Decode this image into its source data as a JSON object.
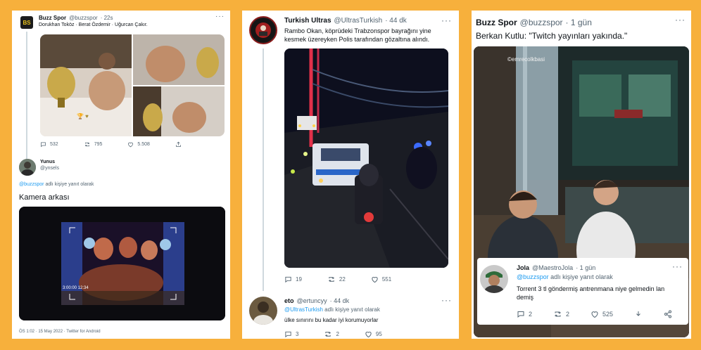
{
  "panel1": {
    "tweet": {
      "avatar_text": "BS",
      "name": "Buzz Spor",
      "handle": "@buzzspor",
      "time": "· 22s",
      "more": "···",
      "text": "Dorukhan Toköz · Berat Özdemir · Uğurcan Çakır.",
      "media_caption": "🏆 ♥",
      "reply_count": "532",
      "retweet_count": "795",
      "like_count": "5.508"
    },
    "reply": {
      "name": "Yunus",
      "handle": "@ynsels",
      "replying_to_handle": "@buzzspor",
      "replying_to_suffix": " adlı kişiye yanıt olarak",
      "text": "Kamera arkası",
      "video_timestamp": "3:00:00 12:34",
      "meta": "ÖS 1:02 · 15 May 2022 · Twitter for Android"
    }
  },
  "panel2": {
    "tweet": {
      "name": "Turkish Ultras",
      "handle": "@UltrasTurkish",
      "time": "· 44 dk",
      "more": "···",
      "avatar_text": "TURKISH ULTRAS",
      "text": "Rambo Okan, köprüdeki Trabzonspor bayrağını yine kesmek üzereyken Polis tarafından gözaltına alındı.",
      "reply_count": "19",
      "retweet_count": "22",
      "like_count": "551"
    },
    "reply": {
      "name": "eto",
      "handle": "@ertuncyy",
      "time": "· 44 dk",
      "more": "···",
      "replying_to_handle": "@UltrasTurkish",
      "replying_to_suffix": " adlı kişiye yanıt olarak",
      "text": "ülke sınırını bu kadar iyi korumuyorlar",
      "reply_count": "3",
      "retweet_count": "2",
      "like_count": "95"
    }
  },
  "panel3": {
    "tweet": {
      "name": "Buzz Spor",
      "handle": "@buzzspor",
      "time": "· 1 gün",
      "more": "···",
      "text": "Berkan Kutlu: \"Twitch yayınları yakında.\"",
      "image_watermark": "©emrecolkbasi"
    },
    "reply": {
      "name": "Jola",
      "handle": "@MaestroJola",
      "time": "· 1 gün",
      "more": "···",
      "replying_to_handle": "@buzzspor",
      "replying_to_suffix": " adlı kişiye yanıt olarak",
      "text": "Torrent 3 tl göndermiş antrenmana niye gelmedin lan demiş",
      "reply_count": "2",
      "retweet_count": "2",
      "like_count": "525"
    }
  },
  "colors": {
    "background": "#f7b03c",
    "link": "#1d9bf0",
    "muted": "#536471"
  }
}
